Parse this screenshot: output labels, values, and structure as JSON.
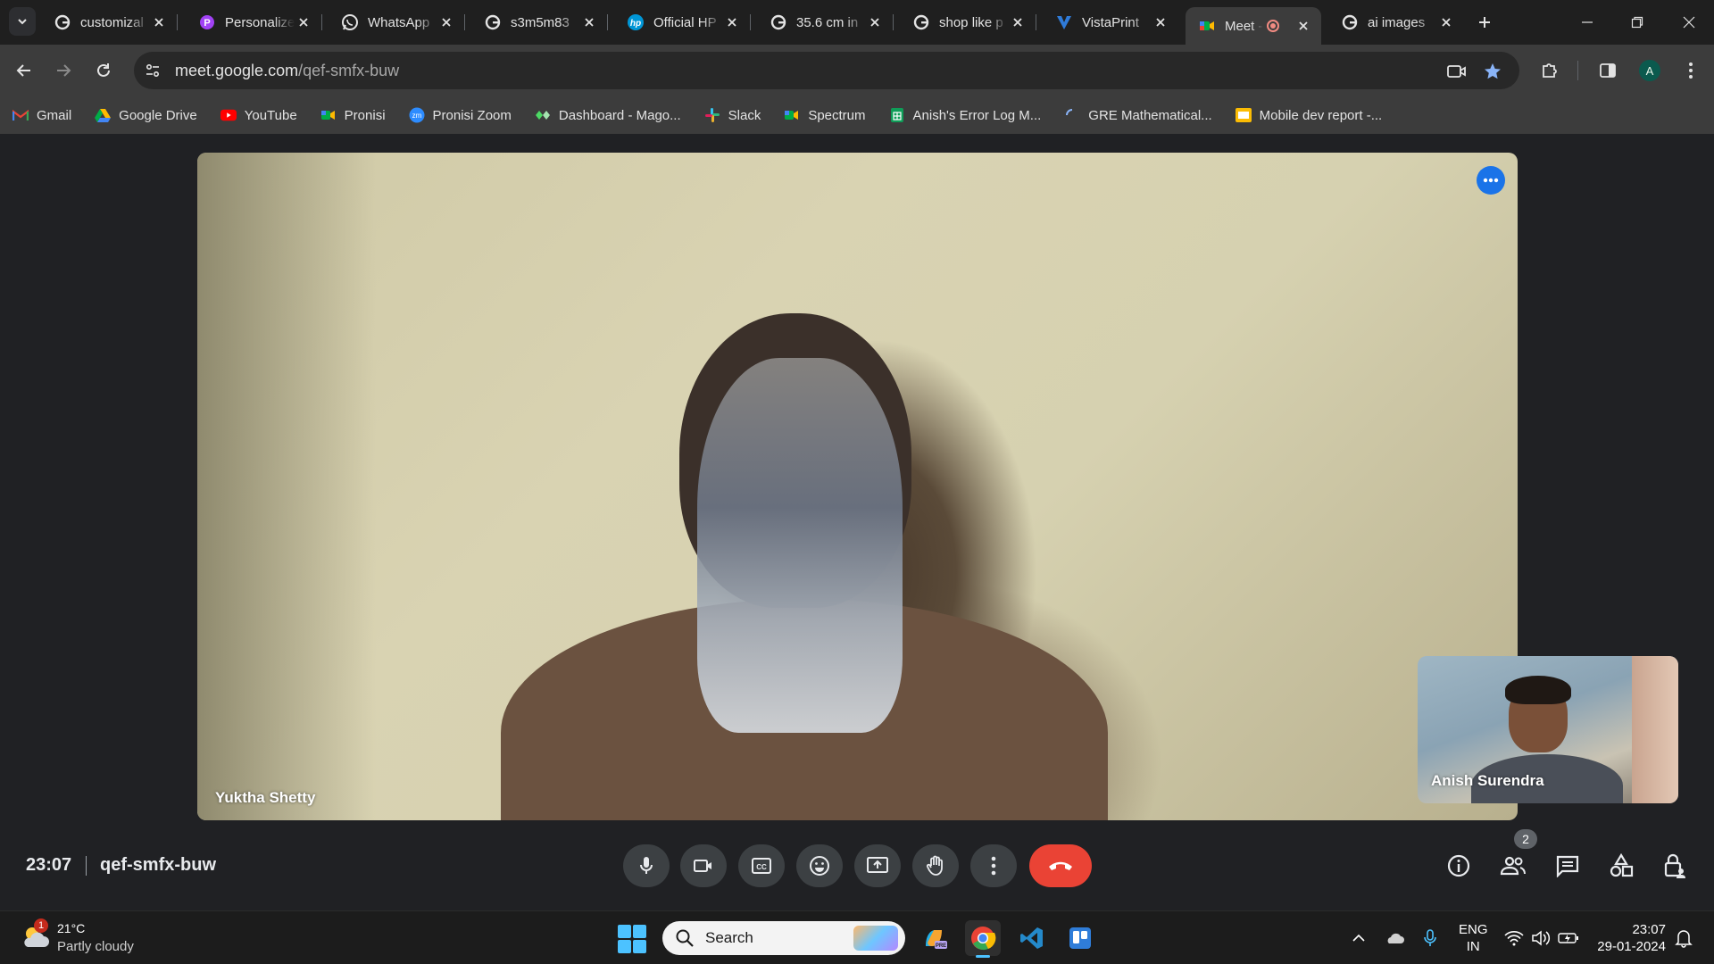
{
  "browser": {
    "tabs": [
      {
        "title": "customizal",
        "icon": "google-icon"
      },
      {
        "title": "Personalize",
        "icon": "pronisi-p-icon"
      },
      {
        "title": "WhatsApp",
        "icon": "whatsapp-icon"
      },
      {
        "title": "s3m5m83",
        "icon": "google-icon"
      },
      {
        "title": "Official HP",
        "icon": "hp-icon"
      },
      {
        "title": "35.6 cm in",
        "icon": "google-icon"
      },
      {
        "title": "shop like p",
        "icon": "google-icon"
      },
      {
        "title": "VistaPrint",
        "icon": "vistaprint-icon"
      },
      {
        "title": "Meet -",
        "icon": "meet-icon",
        "active": true,
        "recording": true
      },
      {
        "title": "ai images",
        "icon": "google-icon"
      }
    ],
    "url_host": "meet.google.com",
    "url_path": "/qef-smfx-buw",
    "profile_initial": "A",
    "bookmarks": [
      {
        "label": "Gmail",
        "icon": "gmail-icon"
      },
      {
        "label": "Google Drive",
        "icon": "drive-icon"
      },
      {
        "label": "YouTube",
        "icon": "youtube-icon"
      },
      {
        "label": "Pronisi",
        "icon": "meet-icon"
      },
      {
        "label": "Pronisi Zoom",
        "icon": "zoom-icon"
      },
      {
        "label": "Dashboard - Mago...",
        "icon": "dashboard-icon"
      },
      {
        "label": "Slack",
        "icon": "slack-icon"
      },
      {
        "label": "Spectrum",
        "icon": "meet-icon"
      },
      {
        "label": "Anish's Error Log M...",
        "icon": "sheets-icon"
      },
      {
        "label": "GRE Mathematical...",
        "icon": "loading-icon"
      },
      {
        "label": "Mobile dev report -...",
        "icon": "slides-icon"
      }
    ]
  },
  "meet": {
    "main_participant": "Yuktha Shetty",
    "self_participant": "Anish Surendra",
    "time": "23:07",
    "meeting_code": "qef-smfx-buw",
    "participant_count": "2",
    "colors": {
      "end_call": "#ea4335",
      "more_button": "#1a73e8",
      "control_bg": "#3c4043"
    }
  },
  "taskbar": {
    "weather_temp": "21°C",
    "weather_condition": "Partly cloudy",
    "weather_badge": "1",
    "search_placeholder": "Search",
    "lang_line1": "ENG",
    "lang_line2": "IN",
    "time": "23:07",
    "date": "29-01-2024"
  }
}
